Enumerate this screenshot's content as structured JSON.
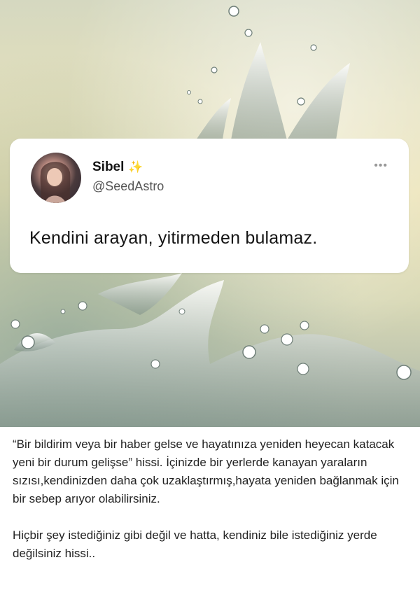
{
  "tweet": {
    "author_name": "Sibel",
    "author_badge": "✨",
    "handle": "@SeedAstro",
    "more_icon": "•••",
    "text": "Kendini arayan, yitirmeden bulamaz."
  },
  "caption": {
    "paragraph_1": "“Bir bildirim veya bir haber gelse ve hayatınıza yeniden heyecan katacak yeni bir durum gelişse” hissi. İçinizde bir yerlerde kanayan yaraların sızısı,kendinizden daha çok uzaklaştırmış,hayata yeniden bağlanmak için bir sebep arıyor olabilirsiniz.",
    "paragraph_2": "Hiçbir şey istediğiniz gibi değil ve hatta, kendiniz bile istediğiniz yerde değilsiniz hissi.."
  },
  "colors": {
    "card_bg": "#ffffff",
    "text_primary": "#141414",
    "text_secondary": "#555555",
    "sparkle": "#e8c45a"
  }
}
